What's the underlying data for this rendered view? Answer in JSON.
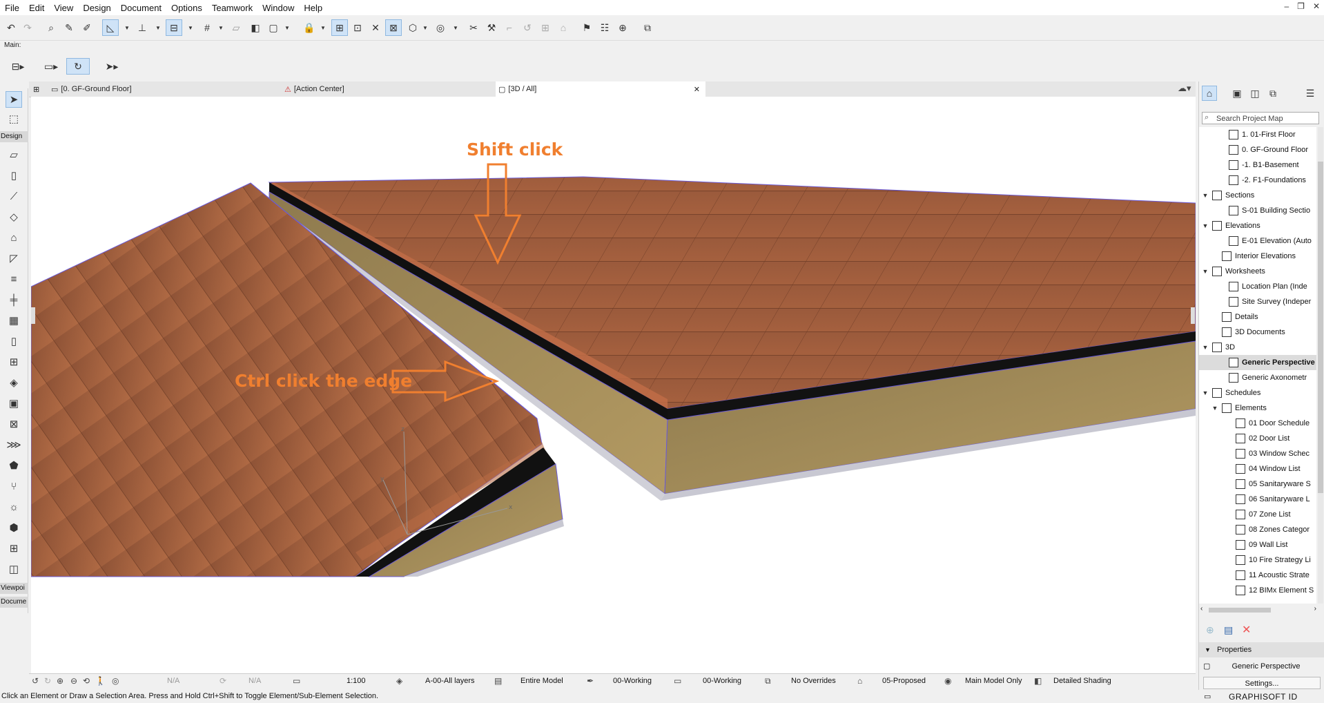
{
  "menu": [
    "File",
    "Edit",
    "View",
    "Design",
    "Document",
    "Options",
    "Teamwork",
    "Window",
    "Help"
  ],
  "window_controls": [
    "–",
    "❐",
    "✕"
  ],
  "toolbar_label": "Main:",
  "tabs": [
    {
      "label": "[0. GF-Ground Floor]",
      "icon": "floor-plan-icon"
    },
    {
      "label": "[Action Center]",
      "icon": "action-center-icon"
    },
    {
      "label": "[3D / All]",
      "icon": "3d-window-icon",
      "close": "✕"
    }
  ],
  "toolbox": {
    "design_label": "Design",
    "viewpoint_label": "Viewpoi",
    "document_label": "Docume"
  },
  "annotations": {
    "shift_click": "Shift click",
    "ctrl_click": "Ctrl click the edge"
  },
  "viewbar": {
    "na1": "N/A",
    "na2": "N/A",
    "scale": "1:100",
    "layer": "A-00-All layers",
    "model": "Entire Model",
    "pen": "00-Working",
    "mvo": "00-Working",
    "override": "No Overrides",
    "renovation": "05-Proposed",
    "structure": "Main Model Only",
    "shading": "Detailed Shading"
  },
  "status_text": "Click an Element or Draw a Selection Area. Press and Hold Ctrl+Shift to Toggle Element/Sub-Element Selection.",
  "navigator": {
    "search_placeholder": "Search Project Map",
    "items": [
      {
        "label": "1. 01-First Floor",
        "level": 3,
        "icon": "story-icon"
      },
      {
        "label": "0. GF-Ground Floor",
        "level": 3,
        "icon": "story-icon"
      },
      {
        "label": "-1. B1-Basement",
        "level": 3,
        "icon": "story-icon"
      },
      {
        "label": "-2. F1-Foundations",
        "level": 3,
        "icon": "story-icon"
      },
      {
        "label": "Sections",
        "level": 1,
        "icon": "sections-folder-icon",
        "expanded": true
      },
      {
        "label": "S-01 Building Sectio",
        "level": 3,
        "icon": "section-icon"
      },
      {
        "label": "Elevations",
        "level": 1,
        "icon": "elevations-folder-icon",
        "expanded": true
      },
      {
        "label": "E-01 Elevation (Auto",
        "level": 3,
        "icon": "elevation-icon"
      },
      {
        "label": "Interior Elevations",
        "level": 2,
        "icon": "interior-elevation-icon"
      },
      {
        "label": "Worksheets",
        "level": 1,
        "icon": "worksheets-folder-icon",
        "expanded": true
      },
      {
        "label": "Location Plan (Inde",
        "level": 3,
        "icon": "worksheet-icon"
      },
      {
        "label": "Site Survey (Indeper",
        "level": 3,
        "icon": "worksheet-icon"
      },
      {
        "label": "Details",
        "level": 2,
        "icon": "details-icon"
      },
      {
        "label": "3D Documents",
        "level": 2,
        "icon": "3d-document-icon"
      },
      {
        "label": "3D",
        "level": 1,
        "icon": "3d-folder-icon",
        "expanded": true
      },
      {
        "label": "Generic Perspective",
        "level": 3,
        "icon": "perspective-icon",
        "selected": true
      },
      {
        "label": "Generic Axonometr",
        "level": 3,
        "icon": "axonometry-icon"
      },
      {
        "label": "Schedules",
        "level": 1,
        "icon": "schedules-folder-icon",
        "expanded": true
      },
      {
        "label": "Elements",
        "level": 2,
        "icon": "elements-folder-icon",
        "expanded": true
      },
      {
        "label": "01 Door Schedule",
        "level": 4,
        "icon": "schedule-icon"
      },
      {
        "label": "02 Door List",
        "level": 4,
        "icon": "schedule-icon"
      },
      {
        "label": "03 Window Schec",
        "level": 4,
        "icon": "schedule-icon"
      },
      {
        "label": "04 Window List",
        "level": 4,
        "icon": "schedule-icon"
      },
      {
        "label": "05 Sanitaryware S",
        "level": 4,
        "icon": "schedule-icon"
      },
      {
        "label": "06 Sanitaryware L",
        "level": 4,
        "icon": "schedule-icon"
      },
      {
        "label": "07 Zone List",
        "level": 4,
        "icon": "schedule-icon"
      },
      {
        "label": "08 Zones Categor",
        "level": 4,
        "icon": "schedule-icon"
      },
      {
        "label": "09 Wall List",
        "level": 4,
        "icon": "schedule-icon"
      },
      {
        "label": "10 Fire Strategy Li",
        "level": 4,
        "icon": "schedule-icon"
      },
      {
        "label": "11 Acoustic Strate",
        "level": 4,
        "icon": "schedule-icon"
      },
      {
        "label": "12 BIMx Element S",
        "level": 4,
        "icon": "schedule-icon"
      }
    ],
    "properties_label": "Properties",
    "properties_value": "Generic Perspective",
    "settings_label": "Settings...",
    "brand": "GRAPHISOFT ID"
  }
}
